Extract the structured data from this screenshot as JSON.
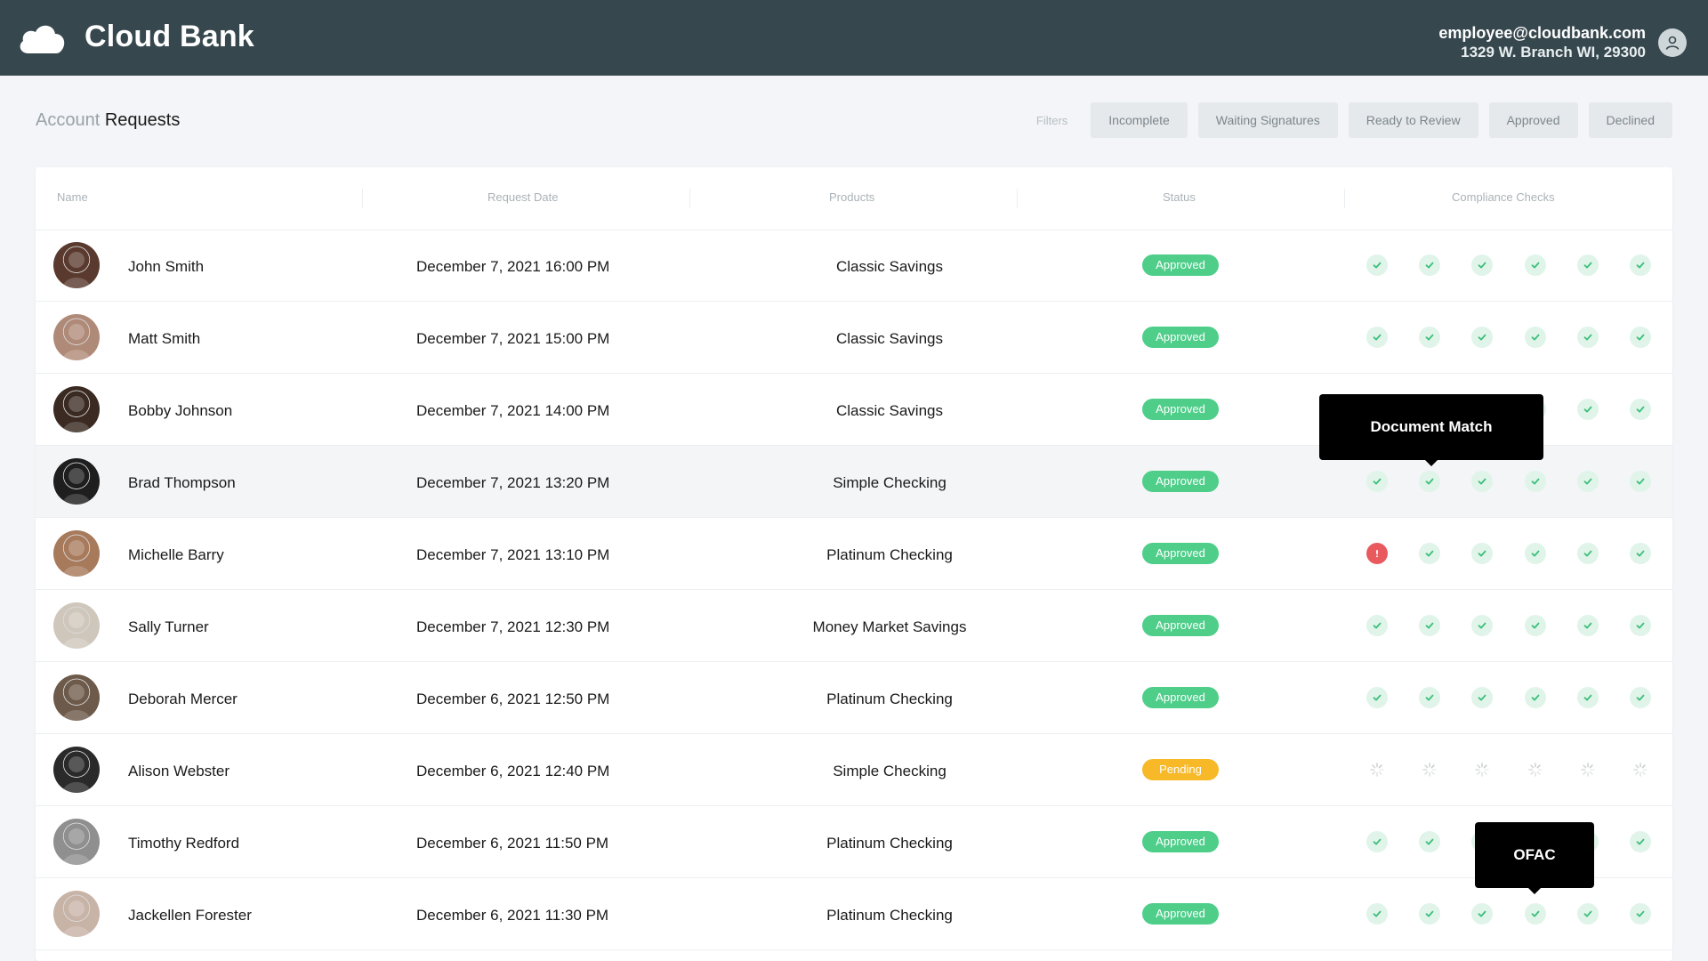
{
  "header": {
    "brand": "Cloud Bank",
    "user_email": "employee@cloudbank.com",
    "user_address": "1329 W. Branch WI, 29300"
  },
  "page": {
    "title_light": "Account",
    "title_dark": "Requests"
  },
  "filters": {
    "label": "Filters",
    "options": [
      "Incomplete",
      "Waiting Signatures",
      "Ready to Review",
      "Approved",
      "Declined"
    ]
  },
  "table": {
    "columns": [
      "Name",
      "Request Date",
      "Products",
      "Status",
      "Compliance Checks"
    ],
    "rows": [
      {
        "name": "John Smith",
        "date": "December 7, 2021 16:00 PM",
        "product": "Classic Savings",
        "status": "Approved",
        "checks": [
          "ok",
          "ok",
          "ok",
          "ok",
          "ok",
          "ok"
        ]
      },
      {
        "name": "Matt Smith",
        "date": "December 7, 2021 15:00 PM",
        "product": "Classic Savings",
        "status": "Approved",
        "checks": [
          "ok",
          "ok",
          "ok",
          "ok",
          "ok",
          "ok"
        ]
      },
      {
        "name": "Bobby Johnson",
        "date": "December 7, 2021 14:00 PM",
        "product": "Classic Savings",
        "status": "Approved",
        "checks": [
          "ok",
          "ok",
          "ok",
          "ok",
          "ok",
          "ok"
        ]
      },
      {
        "name": "Brad Thompson",
        "date": "December 7, 2021 13:20 PM",
        "product": "Simple Checking",
        "status": "Approved",
        "checks": [
          "ok",
          "ok",
          "ok",
          "ok",
          "ok",
          "ok"
        ]
      },
      {
        "name": "Michelle Barry",
        "date": "December 7, 2021 13:10 PM",
        "product": "Platinum Checking",
        "status": "Approved",
        "checks": [
          "err",
          "ok",
          "ok",
          "ok",
          "ok",
          "ok"
        ]
      },
      {
        "name": "Sally Turner",
        "date": "December 7, 2021 12:30 PM",
        "product": "Money Market Savings",
        "status": "Approved",
        "checks": [
          "ok",
          "ok",
          "ok",
          "ok",
          "ok",
          "ok"
        ]
      },
      {
        "name": "Deborah Mercer",
        "date": "December 6, 2021 12:50 PM",
        "product": "Platinum Checking",
        "status": "Approved",
        "checks": [
          "ok",
          "ok",
          "ok",
          "ok",
          "ok",
          "ok"
        ]
      },
      {
        "name": "Alison Webster",
        "date": "December 6, 2021 12:40 PM",
        "product": "Simple Checking",
        "status": "Pending",
        "checks": [
          "pend",
          "pend",
          "pend",
          "pend",
          "pend",
          "pend"
        ]
      },
      {
        "name": "Timothy Redford",
        "date": "December 6, 2021 11:50 PM",
        "product": "Platinum Checking",
        "status": "Approved",
        "checks": [
          "ok",
          "ok",
          "ok",
          "ok",
          "ok",
          "ok"
        ]
      },
      {
        "name": "Jackellen Forester",
        "date": "December 6, 2021 11:30 PM",
        "product": "Platinum Checking",
        "status": "Approved",
        "checks": [
          "ok",
          "ok",
          "ok",
          "ok",
          "ok",
          "ok"
        ]
      }
    ]
  },
  "tooltips": {
    "document_match": "Document Match",
    "ofac": "OFAC"
  },
  "colors": {
    "topbar": "#36474e",
    "approved": "#4fce8a",
    "pending": "#f7b928",
    "error": "#e85a5e",
    "check_bg": "#e0f4ea",
    "check_mark": "#3cbf7a"
  },
  "avatar_colors": [
    "#5a3a2e",
    "#b08a78",
    "#3a2a22",
    "#1e1e1e",
    "#a87a5c",
    "#cfc7bc",
    "#6d5a4a",
    "#2a2a2a",
    "#8f8f8f",
    "#c8b3a7"
  ]
}
